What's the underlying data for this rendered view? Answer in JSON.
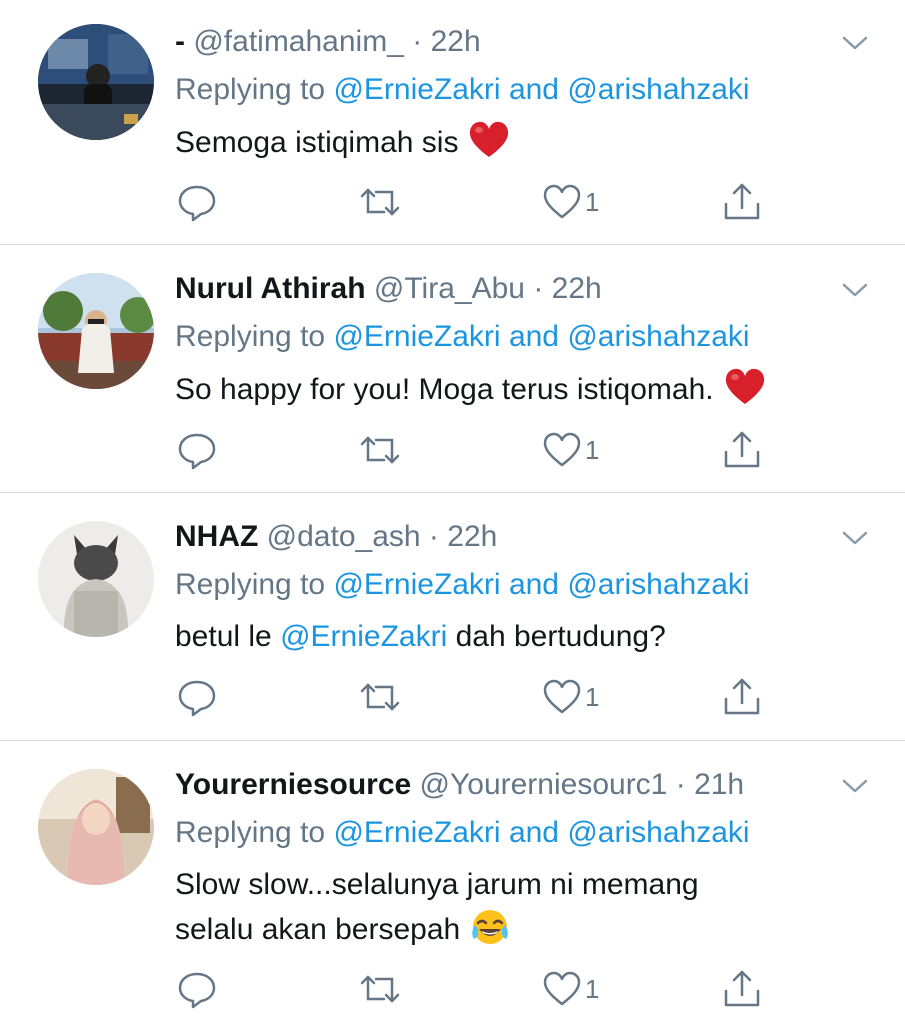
{
  "tweets": [
    {
      "name": "-",
      "handle": "@fatimahanim_",
      "dot": "·",
      "time": "22h",
      "replying": {
        "prefix": "Replying to",
        "to1": "@ErnieZakri",
        "and": "and",
        "to2": "@arishahzaki"
      },
      "text_before": "Semoga istiqimah sis",
      "emoji": "red-heart",
      "likes": "1"
    },
    {
      "name": "Nurul Athirah",
      "handle": "@Tira_Abu",
      "dot": "·",
      "time": "22h",
      "replying": {
        "prefix": "Replying to",
        "to1": "@ErnieZakri",
        "and": "and",
        "to2": "@arishahzaki"
      },
      "text_before": "So happy for you! Moga terus istiqomah.",
      "emoji": "red-heart",
      "likes": "1"
    },
    {
      "name": "NHAZ",
      "handle": "@dato_ash",
      "dot": "·",
      "time": "22h",
      "replying": {
        "prefix": "Replying to",
        "to1": "@ErnieZakri",
        "and": "and",
        "to2": "@arishahzaki"
      },
      "text_before": "betul le",
      "text_mention": "@ErnieZakri",
      "text_after": "dah bertudung?",
      "likes": "1"
    },
    {
      "name": "Yourerniesource",
      "handle": "@Yourerniesourc1",
      "dot": "·",
      "time": "21h",
      "replying": {
        "prefix": "Replying to",
        "to1": "@ErnieZakri",
        "and": "and",
        "to2": "@arishahzaki"
      },
      "text_line1": "Slow slow...selalunya jarum ni memang",
      "text_line2": "selalu akan bersepah",
      "emoji": "face-with-tears-of-joy",
      "likes": "1"
    }
  ],
  "colors": {
    "text": "#14171a",
    "secondary": "#657786",
    "link": "#1b95e0",
    "divider": "#d7dbdf",
    "heart": "#e0245e"
  },
  "icons": [
    "reply-icon",
    "retweet-icon",
    "like-icon",
    "share-icon",
    "chevron-down-icon"
  ]
}
